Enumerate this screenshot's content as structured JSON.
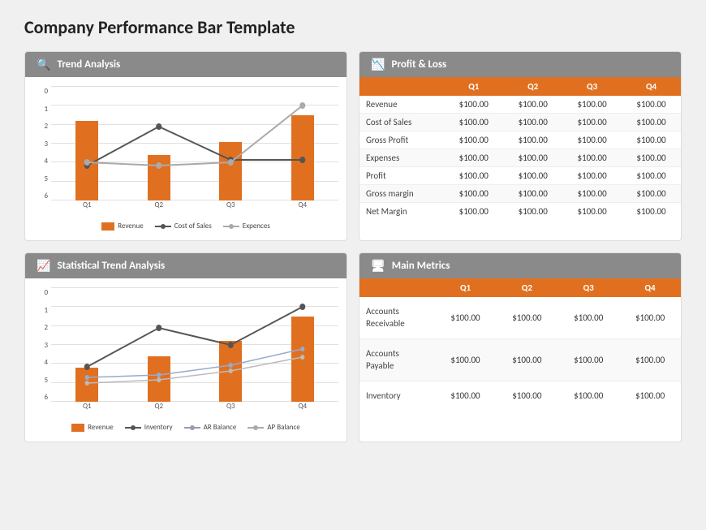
{
  "page": {
    "title": "Company Performance Bar Template"
  },
  "trend_analysis": {
    "title": "Trend Analysis",
    "y_labels": [
      "6",
      "5",
      "4",
      "3",
      "2",
      "1",
      "0"
    ],
    "quarters": [
      "Q1",
      "Q2",
      "Q3",
      "Q4"
    ],
    "bars": [
      4.2,
      2.4,
      3.1,
      4.5
    ],
    "line1": [
      2.5,
      4.3,
      2.8,
      2.8
    ],
    "line2": [
      2.7,
      2.4,
      2.3,
      5.0
    ],
    "legend": [
      "Revenue",
      "Cost of Sales",
      "Expences"
    ]
  },
  "profit_loss": {
    "title": "Profit & Loss",
    "columns": [
      "",
      "Q1",
      "Q2",
      "Q3",
      "Q4"
    ],
    "rows": [
      {
        "label": "Revenue",
        "q1": "$100.00",
        "q2": "$100.00",
        "q3": "$100.00",
        "q4": "$100.00"
      },
      {
        "label": "Cost of Sales",
        "q1": "$100.00",
        "q2": "$100.00",
        "q3": "$100.00",
        "q4": "$100.00"
      },
      {
        "label": "Gross Profit",
        "q1": "$100.00",
        "q2": "$100.00",
        "q3": "$100.00",
        "q4": "$100.00"
      },
      {
        "label": "Expenses",
        "q1": "$100.00",
        "q2": "$100.00",
        "q3": "$100.00",
        "q4": "$100.00"
      },
      {
        "label": "Profit",
        "q1": "$100.00",
        "q2": "$100.00",
        "q3": "$100.00",
        "q4": "$100.00"
      },
      {
        "label": "Gross margin",
        "q1": "$100.00",
        "q2": "$100.00",
        "q3": "$100.00",
        "q4": "$100.00"
      },
      {
        "label": "Net Margin",
        "q1": "$100.00",
        "q2": "$100.00",
        "q3": "$100.00",
        "q4": "$100.00"
      }
    ]
  },
  "statistical_trend": {
    "title": "Statistical Trend Analysis",
    "y_labels": [
      "6",
      "5",
      "4",
      "3",
      "2",
      "1",
      "0"
    ],
    "quarters": [
      "Q1",
      "Q2",
      "Q3",
      "Q4"
    ],
    "bars": [
      1.8,
      2.4,
      3.2,
      4.5
    ],
    "line1": [
      2.5,
      4.3,
      3.2,
      5.0
    ],
    "line2": [
      1.2,
      1.4,
      2.2,
      3.2
    ],
    "line3": [
      1.0,
      1.2,
      1.8,
      2.8
    ],
    "legend": [
      "Revenue",
      "Inventory",
      "AR Balance",
      "AP Balance"
    ]
  },
  "main_metrics": {
    "title": "Main Metrics",
    "columns": [
      "",
      "Q1",
      "Q2",
      "Q3",
      "Q4"
    ],
    "rows": [
      {
        "label": "Accounts Receivable",
        "q1": "$100.00",
        "q2": "$100.00",
        "q3": "$100.00",
        "q4": "$100.00"
      },
      {
        "label": "Accounts Payable",
        "q1": "$100.00",
        "q2": "$100.00",
        "q3": "$100.00",
        "q4": "$100.00"
      },
      {
        "label": "Inventory",
        "q1": "$100.00",
        "q2": "$100.00",
        "q3": "$100.00",
        "q4": "$100.00"
      }
    ]
  }
}
